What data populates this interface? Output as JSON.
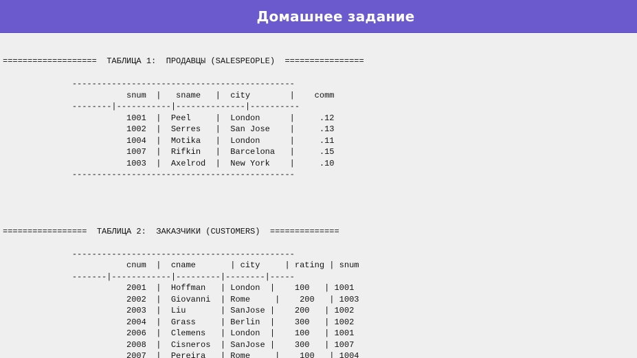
{
  "header": {
    "title": "Домашнее задание"
  },
  "lines": [
    "===================  ТАБЛИЦА 1:  ПРОДАВЦЫ (SALESPEOPLE)  ================",
    "",
    "              ---------------------------------------------",
    "                         snum  |   sname   |  city        |    comm",
    "              --------|-----------|--------------|----------",
    "                         1001  |  Peel     |  London      |     .12",
    "                         1002  |  Serres   |  San Jose    |     .13",
    "                         1004  |  Motika   |  London      |     .11",
    "                         1007  |  Rifkin   |  Barcelona   |     .15",
    "                         1003  |  Axelrod  |  New York    |     .10",
    "              ---------------------------------------------",
    "",
    "",
    "",
    "",
    "=================  ТАБЛИЦА 2:  ЗАКАЗЧИКИ (CUSTOMERS)  ==============",
    "",
    "              ---------------------------------------------",
    "                         cnum  |  cname       | city     | rating | snum",
    "              -------|------------|---------|--------|-----",
    "                         2001  |  Hoffman   | London  |    100   | 1001",
    "                         2002  |  Giovanni  | Rome     |    200   | 1003",
    "                         2003  |  Liu       | SanJose |    200   | 1002",
    "                         2004  |  Grass     | Berlin  |    300   | 1002",
    "                         2006  |  Clemens   | London  |    100   | 1001",
    "                         2008  |  Cisneros  | SanJose |    300   | 1007",
    "                         2007  |  Pereira   | Rome     |    100   | 1004",
    "              ---------------------------------------------"
  ]
}
